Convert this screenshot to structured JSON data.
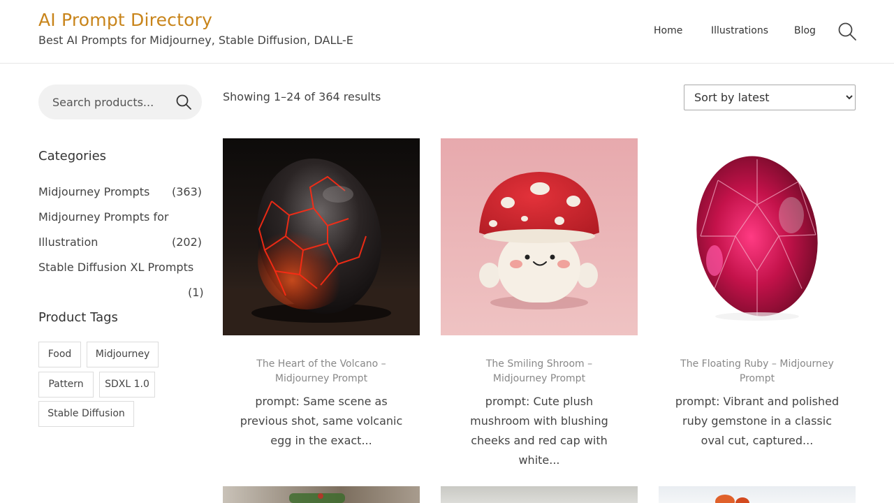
{
  "header": {
    "title": "AI Prompt Directory",
    "tagline": "Best AI Prompts for Midjourney, Stable Diffusion, DALL-E",
    "nav": [
      "Home",
      "Illustrations",
      "Blog"
    ]
  },
  "sidebar": {
    "search_placeholder": "Search products...",
    "categories_title": "Categories",
    "categories": [
      {
        "name": "Midjourney Prompts",
        "count": "(363)"
      },
      {
        "name_line1": "Midjourney Prompts for",
        "name_line2": "Illustration",
        "count": "(202)"
      },
      {
        "name": "Stable Diffusion XL Prompts",
        "count": "(1)"
      }
    ],
    "tags_title": "Product Tags",
    "tags": [
      "Food",
      "Midjourney",
      "Pattern",
      "SDXL 1.0",
      "Stable Diffusion"
    ]
  },
  "main": {
    "result_count": "Showing 1–24 of 364 results",
    "sort_selected": "Sort by latest",
    "products": [
      {
        "title": "The Heart of the Volcano – Midjourney Prompt",
        "desc": "prompt: Same scene as previous shot, same volcanic egg in the exact...",
        "image": "volcanic-egg"
      },
      {
        "title": "The Smiling Shroom – Midjourney Prompt",
        "desc": "prompt: Cute plush mushroom with blushing cheeks and red cap with white...",
        "image": "plush-mushroom"
      },
      {
        "title": "The Floating Ruby – Midjourney Prompt",
        "desc": "prompt: Vibrant and polished ruby gemstone in a classic oval cut, captured...",
        "image": "ruby-gemstone"
      }
    ]
  },
  "colors": {
    "brand": "#c8841a",
    "text": "#444444",
    "muted": "#888888"
  }
}
